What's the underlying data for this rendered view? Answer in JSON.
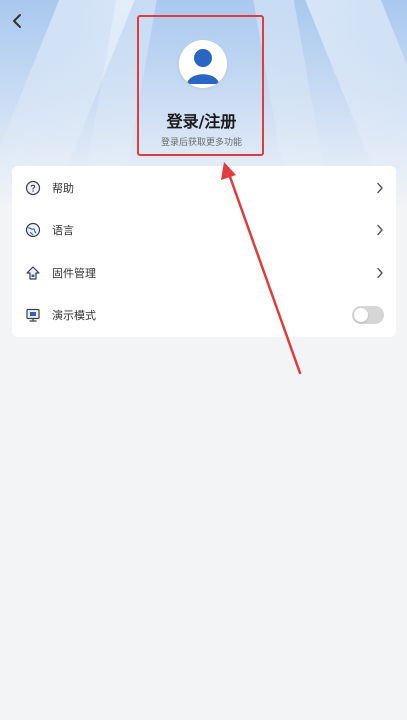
{
  "header": {
    "back_icon": "chevron-left-icon",
    "title": "登录/注册",
    "subtitle": "登录后获取更多功能",
    "avatar_icon": "user-avatar-icon"
  },
  "menu": {
    "items": [
      {
        "label": "帮助",
        "icon": "help-icon",
        "trailing": "chevron-right-icon"
      },
      {
        "label": "语言",
        "icon": "globe-icon",
        "trailing": "chevron-right-icon"
      },
      {
        "label": "固件管理",
        "icon": "firmware-icon",
        "trailing": "chevron-right-icon"
      },
      {
        "label": "演示模式",
        "icon": "demo-monitor-icon",
        "trailing": "toggle",
        "toggle_on": false
      }
    ]
  },
  "colors": {
    "accent": "#2a65c4",
    "highlight": "#e23b3b",
    "background": "#f3f4f6"
  }
}
